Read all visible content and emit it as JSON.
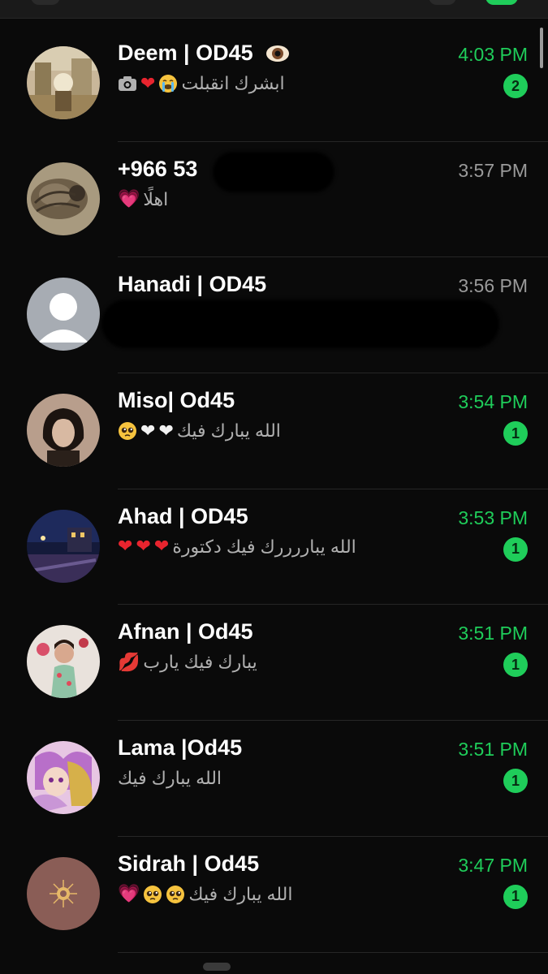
{
  "chats": [
    {
      "name": "Deem | OD45",
      "time": "4:03 PM",
      "unread": "2",
      "preview_text": "ابشرك انقبلت",
      "preview_icons": [
        "camera-icon",
        "red-heart-emoji",
        "crying-face-emoji"
      ],
      "name_icon": "eye-emoji",
      "avatar": "painting-photo"
    },
    {
      "name": "+966 53",
      "time": "3:57 PM",
      "unread": "",
      "preview_text": "اهلًا",
      "preview_icons": [
        "pink-heart-emoji"
      ],
      "avatar": "cat-photo"
    },
    {
      "name": "Hanadi | OD45",
      "time": "3:56 PM",
      "unread": "",
      "preview_text": "",
      "preview_icons": [
        "double-check-icon"
      ],
      "avatar": "default-user-icon"
    },
    {
      "name": "Miso| Od45",
      "time": "3:54 PM",
      "unread": "1",
      "preview_text": "الله يبارك فيك",
      "preview_icons": [
        "white-heart-emoji",
        "white-heart-emoji",
        "pleading-face-emoji"
      ],
      "avatar": "portrait-photo"
    },
    {
      "name": "Ahad | OD45",
      "time": "3:53 PM",
      "unread": "1",
      "preview_text": "الله يباررررك فيك دكتورة",
      "preview_icons": [
        "red-heart-emoji",
        "red-heart-emoji",
        "red-heart-emoji"
      ],
      "avatar": "night-street-photo"
    },
    {
      "name": "Afnan | Od45",
      "time": "3:51 PM",
      "unread": "1",
      "preview_text": "يبارك فيك يارب",
      "preview_icons": [
        "kiss-mark-emoji"
      ],
      "avatar": "girl-photo"
    },
    {
      "name": "Lama |Od45",
      "time": "3:51 PM",
      "unread": "1",
      "preview_text": "الله يبارك فيك",
      "preview_icons": [],
      "avatar": "anime-photo"
    },
    {
      "name": "Sidrah | Od45",
      "time": "3:47 PM",
      "unread": "1",
      "preview_text": "الله يبارك فيك",
      "preview_icons": [
        "pink-heart-emoji",
        "pleading-face-emoji",
        "pleading-face-emoji"
      ],
      "avatar": "sun-emblem-photo"
    }
  ],
  "colors": {
    "background": "#0a0a0a",
    "accent_green": "#1fcd5a",
    "time_gray": "#9a9a9a",
    "preview_gray": "#b0b0b0"
  }
}
